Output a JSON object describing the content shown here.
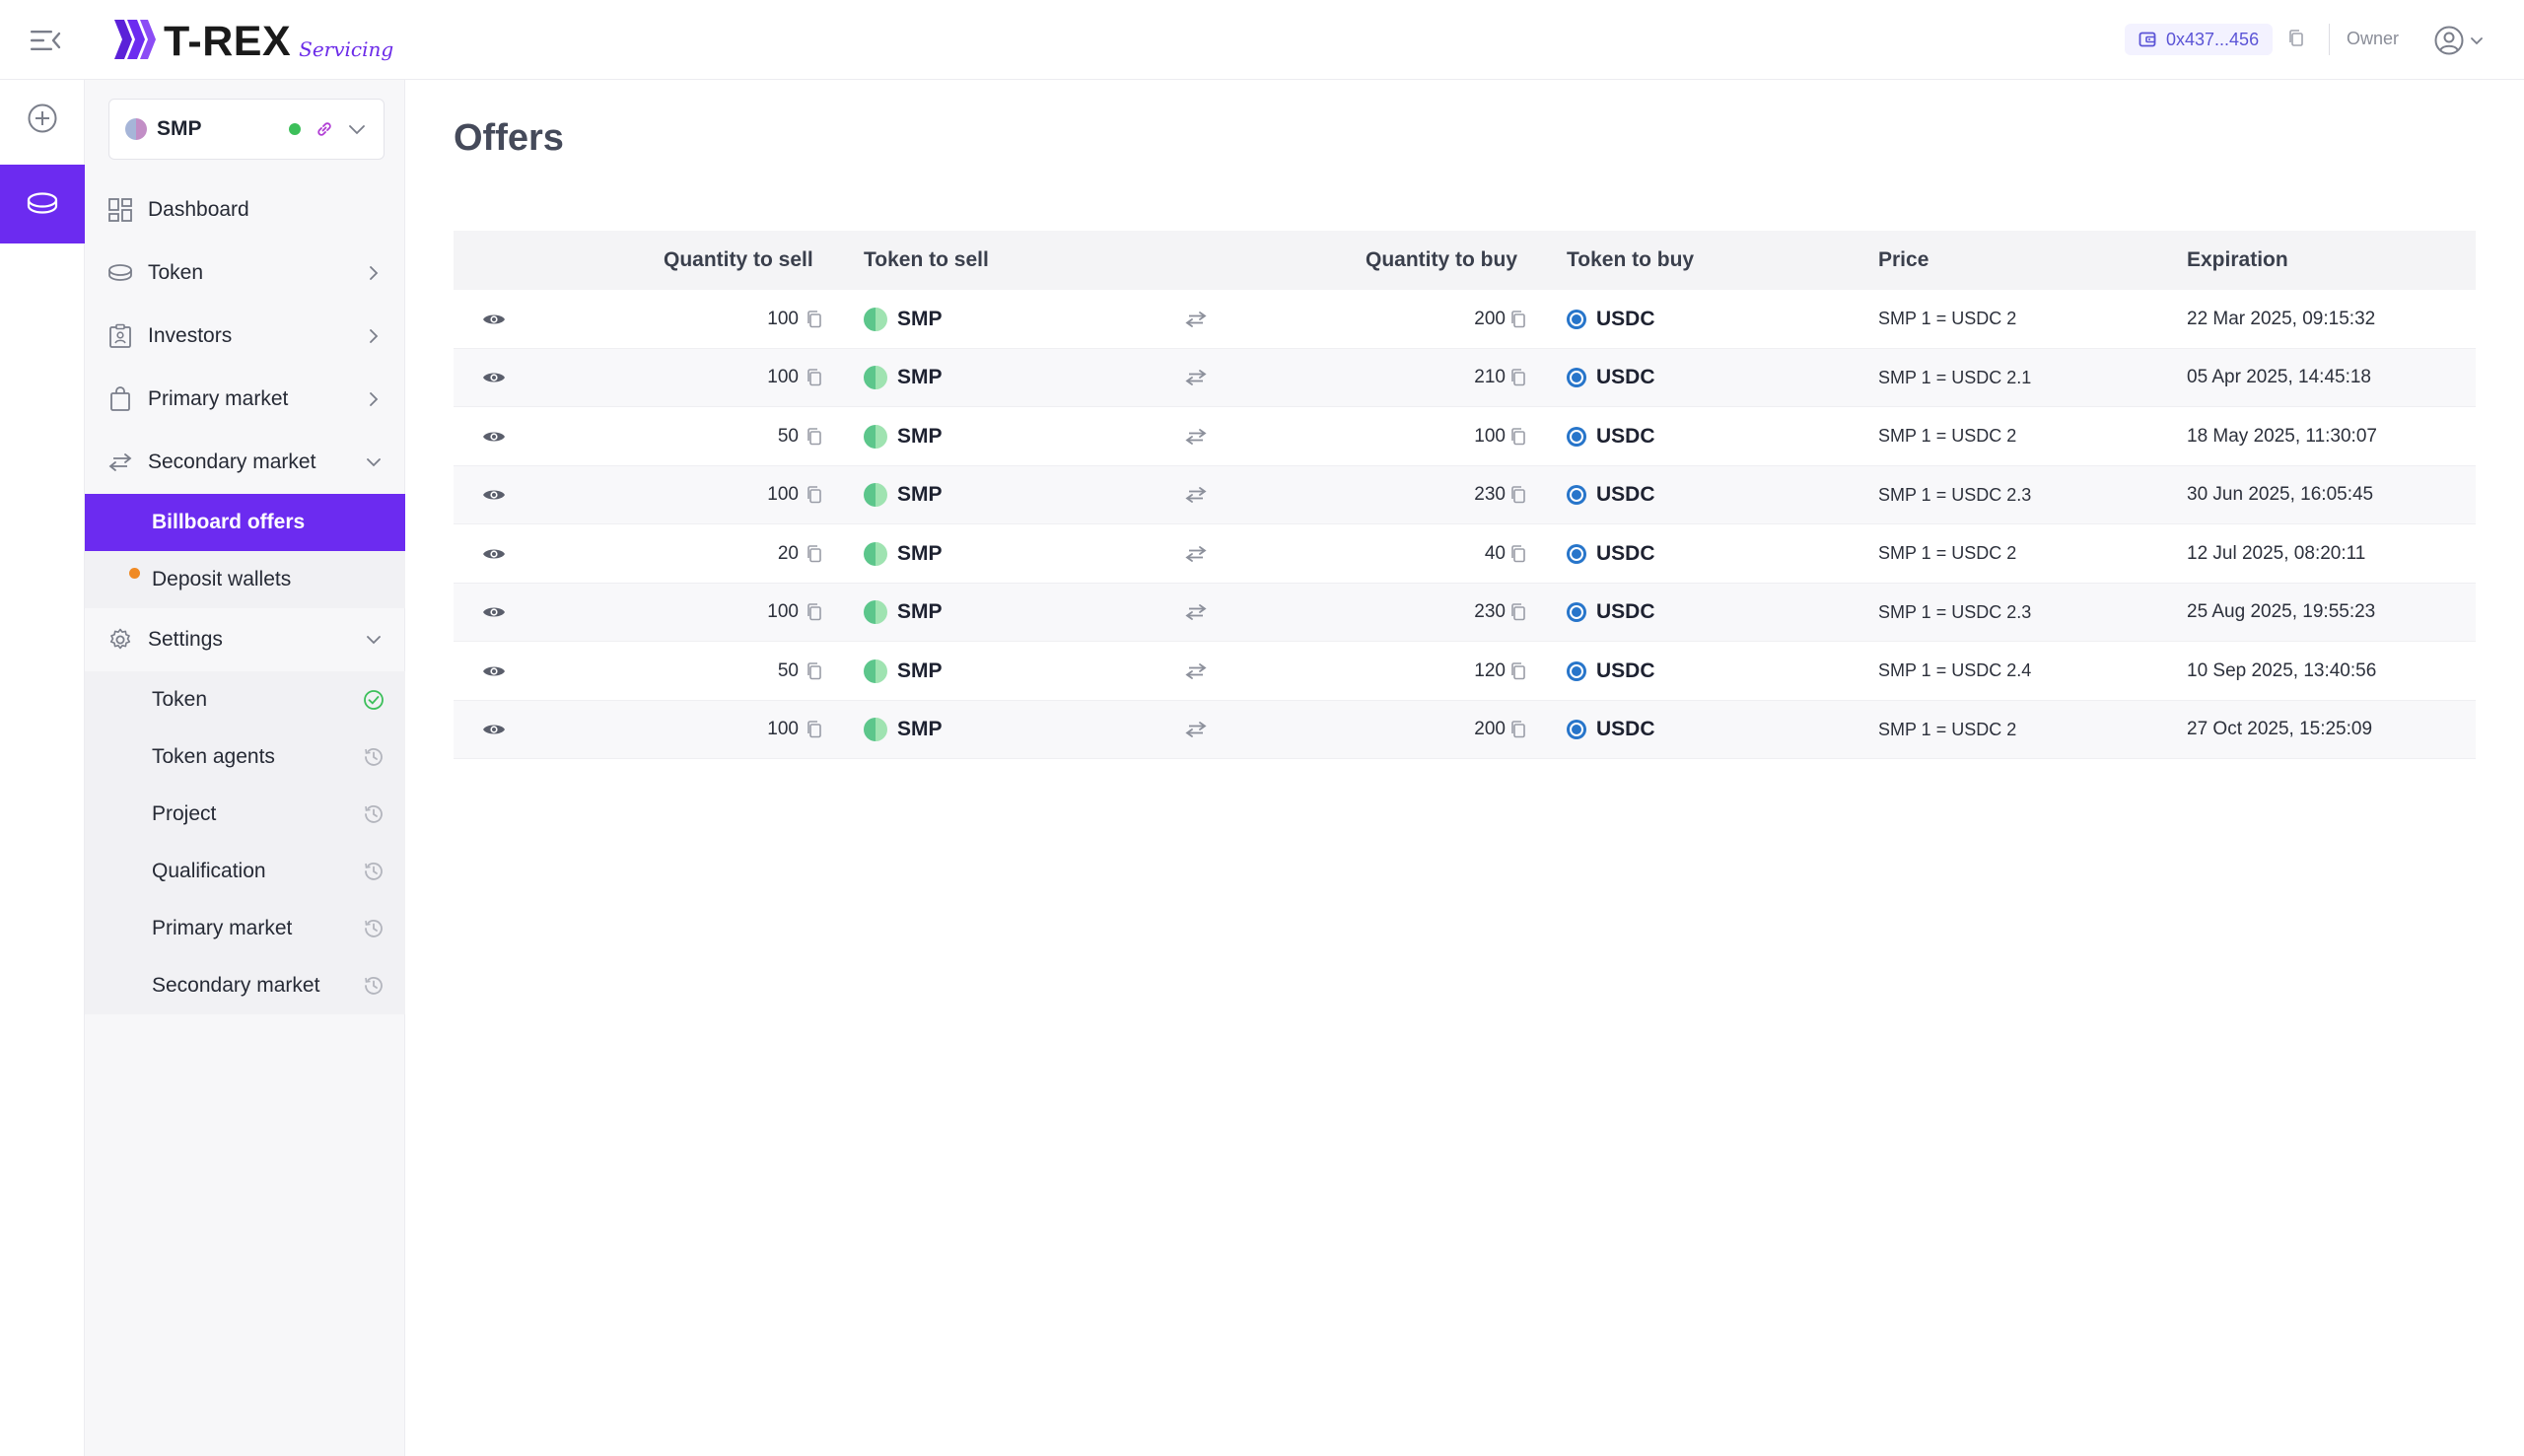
{
  "header": {
    "logo_text": "T-REX",
    "logo_sub": "Servicing",
    "wallet_address": "0x437...456",
    "role": "Owner"
  },
  "token_selector": {
    "name": "SMP"
  },
  "nav": {
    "dashboard": "Dashboard",
    "token": "Token",
    "investors": "Investors",
    "primary_market": "Primary market",
    "secondary_market": "Secondary market",
    "billboard_offers": "Billboard offers",
    "deposit_wallets": "Deposit wallets",
    "settings": "Settings",
    "settings_items": [
      {
        "label": "Token",
        "status": "done"
      },
      {
        "label": "Token agents",
        "status": "pending"
      },
      {
        "label": "Project",
        "status": "pending"
      },
      {
        "label": "Qualification",
        "status": "pending"
      },
      {
        "label": "Primary market",
        "status": "pending"
      },
      {
        "label": "Secondary market",
        "status": "pending"
      }
    ]
  },
  "page": {
    "title": "Offers"
  },
  "table": {
    "headers": {
      "quantity_to_sell": "Quantity to sell",
      "token_to_sell": "Token to sell",
      "quantity_to_buy": "Quantity to buy",
      "token_to_buy": "Token to buy",
      "price": "Price",
      "expiration": "Expiration"
    },
    "rows": [
      {
        "qty_sell": "100",
        "token_sell": "SMP",
        "qty_buy": "200",
        "token_buy": "USDC",
        "price": "SMP 1 = USDC 2",
        "expiration": "22 Mar 2025, 09:15:32"
      },
      {
        "qty_sell": "100",
        "token_sell": "SMP",
        "qty_buy": "210",
        "token_buy": "USDC",
        "price": "SMP 1 = USDC 2.1",
        "expiration": "05 Apr 2025, 14:45:18"
      },
      {
        "qty_sell": "50",
        "token_sell": "SMP",
        "qty_buy": "100",
        "token_buy": "USDC",
        "price": "SMP 1 = USDC 2",
        "expiration": "18 May 2025, 11:30:07"
      },
      {
        "qty_sell": "100",
        "token_sell": "SMP",
        "qty_buy": "230",
        "token_buy": "USDC",
        "price": "SMP 1 = USDC 2.3",
        "expiration": "30 Jun 2025, 16:05:45"
      },
      {
        "qty_sell": "20",
        "token_sell": "SMP",
        "qty_buy": "40",
        "token_buy": "USDC",
        "price": "SMP 1 = USDC 2",
        "expiration": "12 Jul 2025, 08:20:11"
      },
      {
        "qty_sell": "100",
        "token_sell": "SMP",
        "qty_buy": "230",
        "token_buy": "USDC",
        "price": "SMP 1 = USDC 2.3",
        "expiration": "25 Aug 2025, 19:55:23"
      },
      {
        "qty_sell": "50",
        "token_sell": "SMP",
        "qty_buy": "120",
        "token_buy": "USDC",
        "price": "SMP 1 = USDC 2.4",
        "expiration": "10 Sep 2025, 13:40:56"
      },
      {
        "qty_sell": "100",
        "token_sell": "SMP",
        "qty_buy": "200",
        "token_buy": "USDC",
        "price": "SMP 1 = USDC 2",
        "expiration": "27 Oct 2025, 15:25:09"
      }
    ]
  },
  "colors": {
    "accent": "#6c2bf0",
    "status_ok": "#3cbf5a",
    "status_warning": "#f08a24"
  }
}
